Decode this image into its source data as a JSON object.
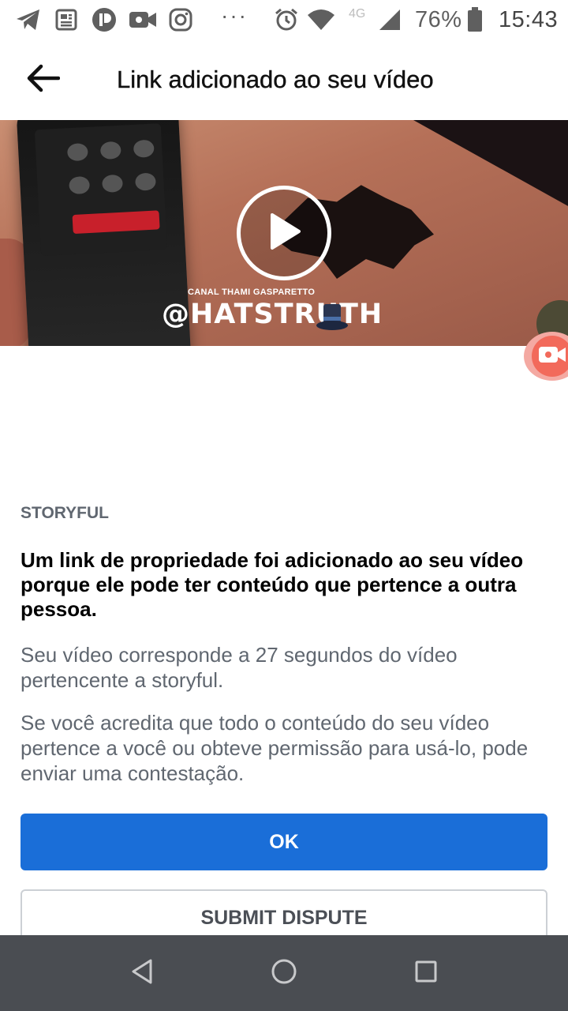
{
  "status_bar": {
    "network": "4G",
    "battery": "76%",
    "time": "15:43",
    "dots": "···",
    "icons": [
      "telegram-icon",
      "news-icon",
      "app-icon",
      "video-call-icon",
      "instagram-icon",
      "alarm-icon",
      "wifi-icon",
      "signal-icon",
      "battery-icon"
    ]
  },
  "header": {
    "title": "Link adicionado ao seu vídeo",
    "back_icon": "arrow-left-icon"
  },
  "video": {
    "channel": "CANAL THAMI GASPARETTO",
    "handle": "@HATSTRUTH",
    "play_icon": "play-icon"
  },
  "content": {
    "owner": "STORYFUL",
    "headline": "Um link de propriedade foi adicionado ao seu vídeo porque ele pode ter conteúdo que pertence a outra pessoa.",
    "match_text": "Seu vídeo corresponde a 27 segundos do vídeo pertencente a storyful.",
    "dispute_text": "Se você acredita que todo o conteúdo do seu vídeo pertence a você ou obteve permissão para usá-lo, pode enviar uma contestação."
  },
  "buttons": {
    "ok": "OK",
    "submit_dispute": "SUBMIT DISPUTE"
  },
  "colors": {
    "primary": "#1a6ed8",
    "nav_bar": "#4a4d52",
    "secondary_text": "#606770"
  }
}
